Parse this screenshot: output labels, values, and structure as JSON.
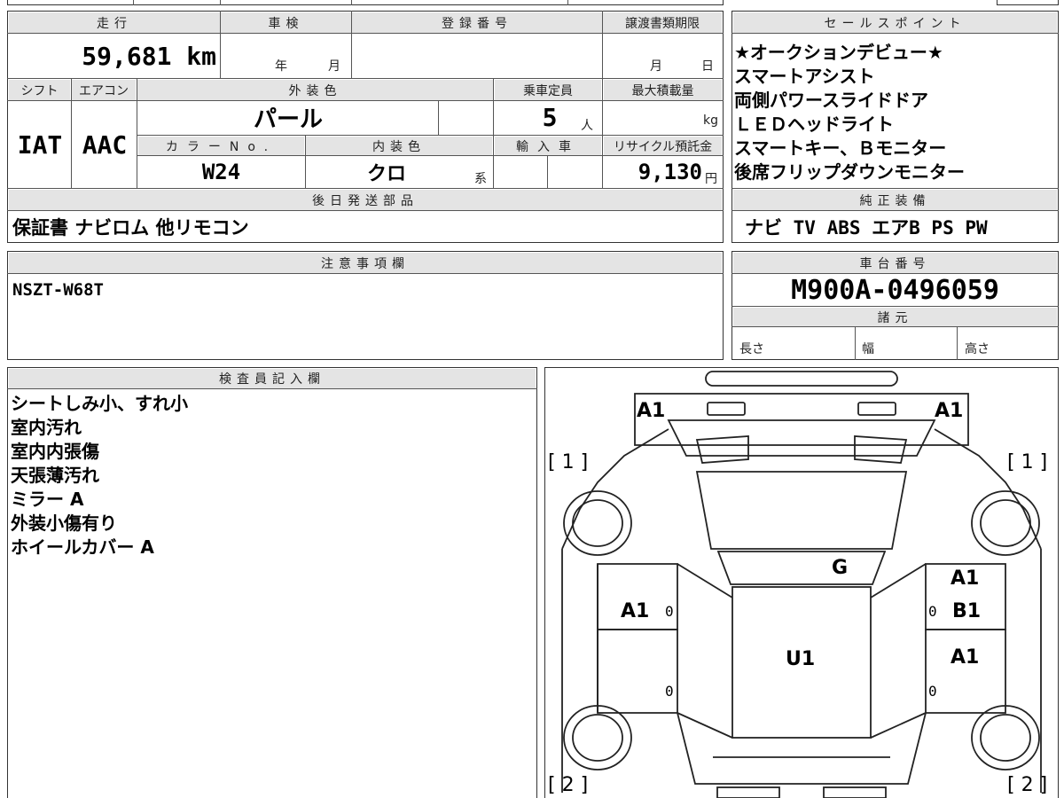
{
  "main_table": {
    "headers": {
      "mileage": "走行",
      "shaken": "車検",
      "registration": "登録番号",
      "transfer_deadline": "譲渡書類期限",
      "shift": "シフト",
      "aircon": "エアコン",
      "exterior_color": "外装色",
      "capacity": "乗車定員",
      "max_load": "最大積載量",
      "color_no": "カラーNo.",
      "interior_color": "内装色",
      "import": "輸入車",
      "recycle": "リサイクル預託金",
      "later_parts": "後日発送部品"
    },
    "mileage_value": "59,681 km",
    "shaken_year_unit": "年",
    "shaken_month_unit": "月",
    "transfer_month_unit": "月",
    "transfer_day_unit": "日",
    "shift_value": "IAT",
    "aircon_value": "AAC",
    "exterior_value": "パール",
    "capacity_value": "5",
    "capacity_unit": "人",
    "max_load_unit": "kg",
    "color_no_value": "W24",
    "interior_value": "クロ",
    "interior_suffix": "系",
    "recycle_value": "9,130",
    "recycle_unit": "円",
    "later_parts_value": "保証書 ナビロム 他リモコン"
  },
  "sales_points": {
    "header": "セールスポイント",
    "lines": [
      "★オークションデビュー★",
      "スマートアシスト",
      "両側パワースライドドア",
      "ＬＥＤヘッドライト",
      "スマートキー、Ｂモニター",
      "後席フリップダウンモニター"
    ]
  },
  "genuine_equipment": {
    "header": "純正装備",
    "value": "ナビ TV ABS エアB PS PW"
  },
  "notes": {
    "header": "注意事項欄",
    "value": "NSZT-W68T"
  },
  "chassis": {
    "header": "車台番号",
    "value": "M900A-0496059"
  },
  "specs": {
    "header": "諸元",
    "length_label": "長さ",
    "width_label": "幅",
    "height_label": "高さ"
  },
  "inspector": {
    "header": "検査員記入欄",
    "lines": [
      "シートしみ小、すれ小",
      "室内汚れ",
      "室内内張傷",
      "天張薄汚れ",
      "ミラー A",
      "外装小傷有り",
      "ホイールカバー A"
    ]
  },
  "diagram": {
    "labels": {
      "front_left": "A1",
      "front_right": "A1",
      "bonnet": "G",
      "front_door_left": "A1",
      "front_door_right": "A1",
      "slide_door_right": "B1",
      "roof": "U1",
      "rear_door_right": "A1"
    },
    "brackets": {
      "top_left": "[ 1 ]",
      "top_right": "[ 1 ]",
      "bottom_left": "[ 2 ]",
      "bottom_right": "[ 2 ]"
    },
    "zeros": [
      "0",
      "0",
      "0",
      "0"
    ]
  }
}
